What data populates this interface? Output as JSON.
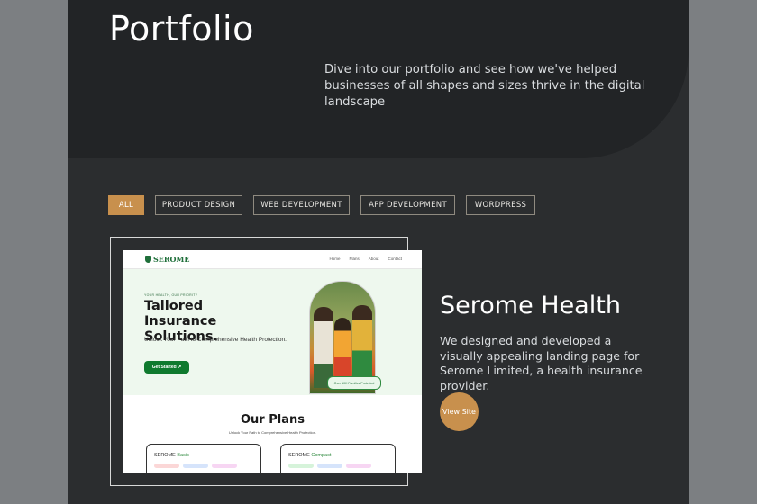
{
  "header": {
    "title": "Portfolio",
    "intro": "Dive into our portfolio and see how we've helped businesses of all shapes and sizes thrive in the digital landscape"
  },
  "filters": [
    {
      "label": "ALL",
      "active": true
    },
    {
      "label": "PRODUCT DESIGN",
      "active": false
    },
    {
      "label": "WEB DEVELOPMENT",
      "active": false
    },
    {
      "label": "APP DEVELOPMENT",
      "active": false
    },
    {
      "label": "WORDPRESS",
      "active": false
    }
  ],
  "project": {
    "title": "Serome Health",
    "description": "We designed and developed a visually appealing landing page for Serome Limited, a health insurance provider.",
    "cta": "View Site"
  },
  "preview": {
    "logo": "SEROME",
    "nav": [
      "Home",
      "Plans",
      "About",
      "Contact"
    ],
    "kicker": "YOUR HEALTH, OUR PRIORITY",
    "headline": "Tailored Insurance Solutions.",
    "subtext": "Unlock Your Path to Comprehensive Health Protection.",
    "button": "Get Started ↗",
    "badge": "Over 10K Families Protected",
    "plans_title": "Our Plans",
    "plans_subtitle": "Unlock Your Path to Comprehensive Health Protection.",
    "plans": [
      {
        "brand": "SEROME",
        "tier": "Basic"
      },
      {
        "brand": "SEROME",
        "tier": "Compact"
      }
    ]
  },
  "colors": {
    "accent": "#c8904d",
    "background": "#2b2d2f",
    "hero_background": "#222426",
    "site_green": "#0f7a2e"
  }
}
